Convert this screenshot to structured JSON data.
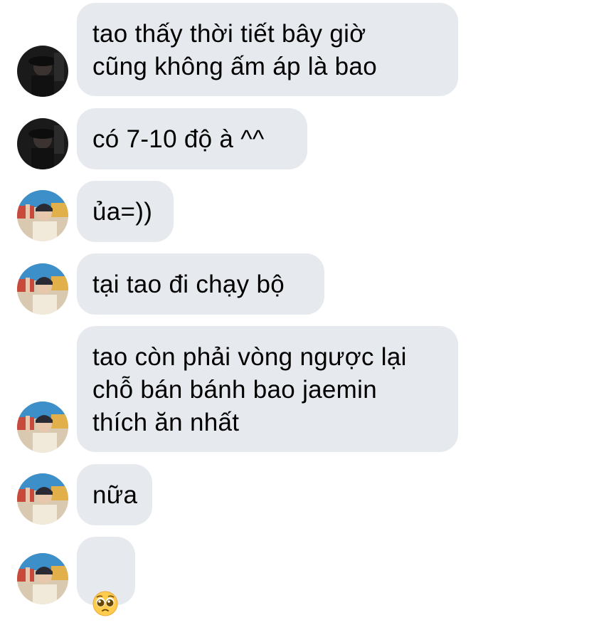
{
  "messages": [
    {
      "sender": "user-a",
      "text": "tao thấy thời tiết bây giờ\ncũng không ấm áp là bao"
    },
    {
      "sender": "user-a",
      "text": "có 7-10 độ à ^^"
    },
    {
      "sender": "user-b",
      "text": "ủa=))"
    },
    {
      "sender": "user-b",
      "text": "tại tao đi chạy bộ"
    },
    {
      "sender": "user-b",
      "text": "tao còn phải vòng ngược lại\nchỗ bán bánh bao jaemin\nthích ăn nhất"
    },
    {
      "sender": "user-b",
      "text": "nữa"
    },
    {
      "sender": "user-b",
      "emoji": "pleading-face-emoji"
    }
  ],
  "colors": {
    "bubble": "#e6e9ed",
    "text": "#000000",
    "background": "#ffffff"
  }
}
